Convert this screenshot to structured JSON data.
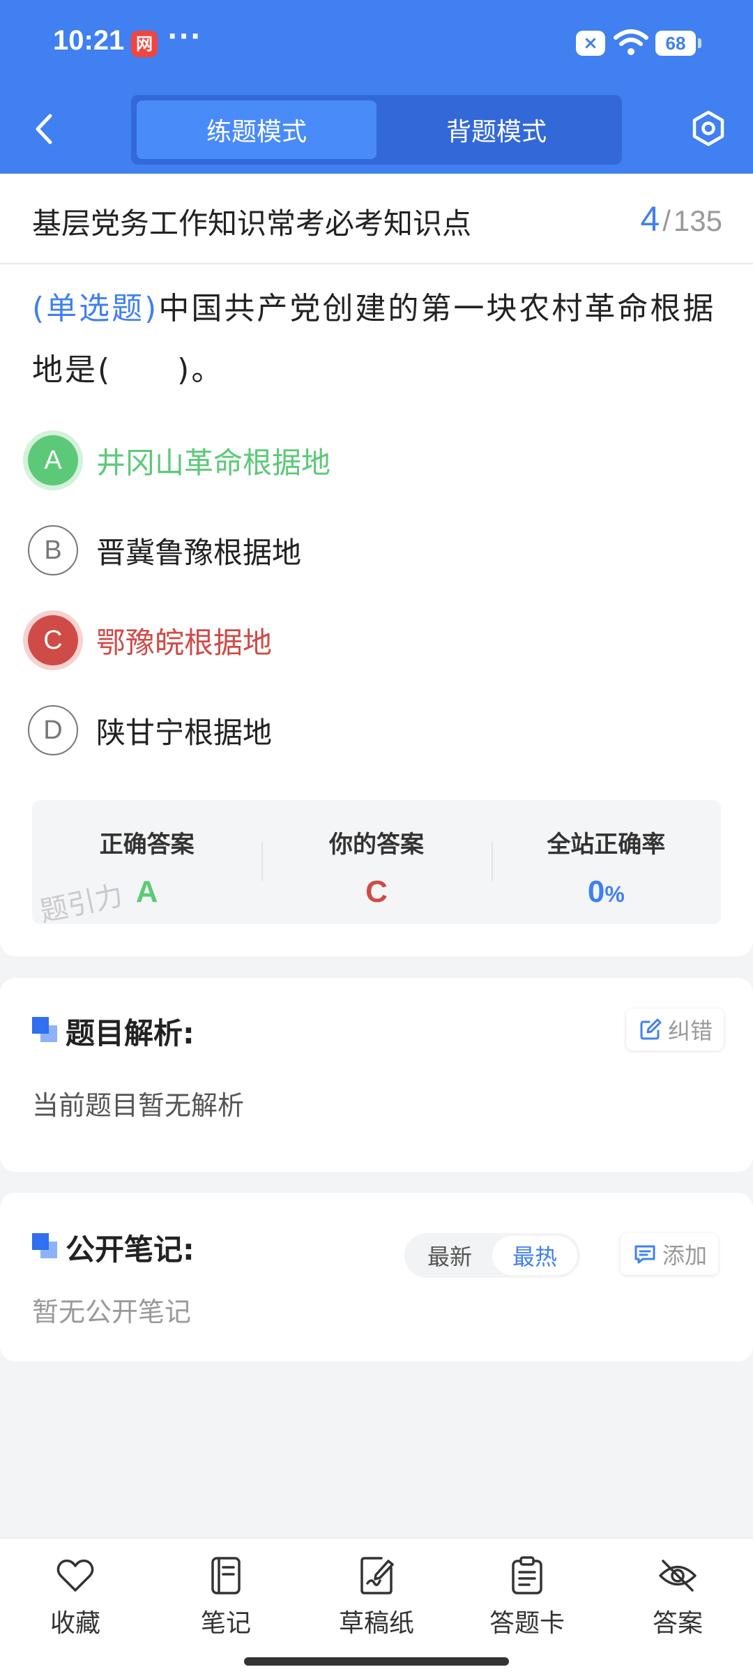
{
  "status_bar": {
    "time": "10:21",
    "app_icon": "网",
    "more": "···",
    "x_badge": "×",
    "battery": "68"
  },
  "nav": {
    "tabs": [
      {
        "label": "练题模式",
        "active": true
      },
      {
        "label": "背题模式",
        "active": false
      }
    ]
  },
  "question": {
    "bank_title": "基层党务工作知识常考必考知识点",
    "current": "4",
    "separator": "/",
    "total": "135",
    "type": "(单选题)",
    "stem": "中国共产党创建的第一块农村革命根据地是(　　)。",
    "options": [
      {
        "letter": "A",
        "text": "井冈山革命根据地",
        "state": "correct"
      },
      {
        "letter": "B",
        "text": "晋冀鲁豫根据地",
        "state": "normal"
      },
      {
        "letter": "C",
        "text": "鄂豫皖根据地",
        "state": "wrong"
      },
      {
        "letter": "D",
        "text": "陕甘宁根据地",
        "state": "normal"
      }
    ]
  },
  "answer_summary": {
    "correct_label": "正确答案",
    "correct_value": "A",
    "yours_label": "你的答案",
    "yours_value": "C",
    "rate_label": "全站正确率",
    "rate_value": "0",
    "rate_unit": "%",
    "watermark": "题引力"
  },
  "analysis": {
    "title": "题目解析:",
    "report_button": "纠错",
    "body": "当前题目暂无解析"
  },
  "notes": {
    "title": "公开笔记:",
    "sort_options": [
      {
        "label": "最新",
        "active": false
      },
      {
        "label": "最热",
        "active": true
      }
    ],
    "add_button": "添加",
    "empty_text": "暂无公开笔记"
  },
  "toolbar": {
    "favorite": "收藏",
    "notes": "笔记",
    "scratch": "草稿纸",
    "answer_card": "答题卡",
    "answer": "答案"
  },
  "colors": {
    "primary": "#4080f0",
    "correct": "#5cc978",
    "wrong": "#cf4b47"
  }
}
